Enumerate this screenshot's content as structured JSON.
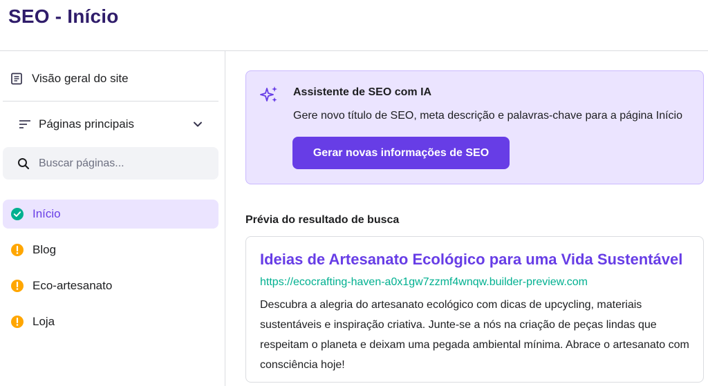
{
  "header": {
    "title": "SEO - Início"
  },
  "sidebar": {
    "overview_label": "Visão geral do site",
    "main_pages_label": "Páginas principais",
    "search": {
      "placeholder": "Buscar páginas...",
      "value": ""
    },
    "pages": [
      {
        "label": "Início",
        "status": "ok",
        "active": true
      },
      {
        "label": "Blog",
        "status": "warning",
        "active": false
      },
      {
        "label": "Eco-artesanato",
        "status": "warning",
        "active": false
      },
      {
        "label": "Loja",
        "status": "warning",
        "active": false
      }
    ]
  },
  "ai_assistant": {
    "title": "Assistente de SEO com IA",
    "description": "Gere novo título de SEO, meta descrição e palavras-chave para a página Início",
    "button_label": "Gerar novas informações de SEO"
  },
  "preview": {
    "heading": "Prévia do resultado de busca",
    "title": "Ideias de Artesanato Ecológico para uma Vida Sustentável",
    "url": "https://ecocrafting-haven-a0x1gw7zzmf4wnqw.builder-preview.com",
    "description": "Descubra a alegria do artesanato ecológico com dicas de upcycling, materiais sustentáveis e inspiração criativa. Junte-se a nós na criação de peças lindas que respeitam o planeta e deixam uma pegada ambiental mínima. Abrace o artesanato com consciência hoje!"
  },
  "colors": {
    "accent": "#673de6",
    "accent_light": "#ebe4ff",
    "title_dark": "#2f1c6a",
    "url_green": "#00b090",
    "status_ok": "#00b090",
    "status_warning": "#ffa600"
  },
  "icons": {
    "overview": "document-icon",
    "main_pages": "filter-icon",
    "dropdown": "chevron-down-icon",
    "search": "search-icon",
    "status_ok": "check-circle-icon",
    "status_warning": "warning-circle-icon",
    "ai": "sparkle-icon"
  }
}
